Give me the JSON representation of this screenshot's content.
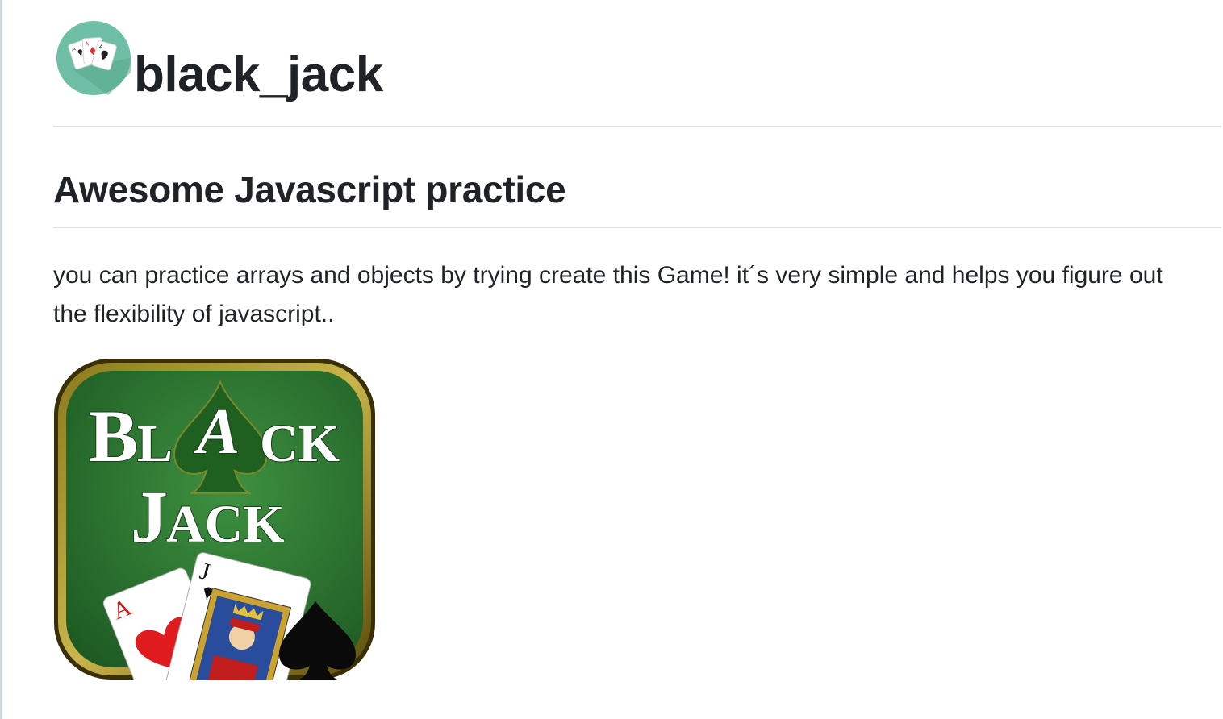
{
  "repo": {
    "title": "black_jack",
    "logo_icon": "playing-cards-logo-icon"
  },
  "section": {
    "heading": "Awesome Javascript practice",
    "paragraph": "you can practice arrays and objects by trying create this Game! it´s very simple and helps you figure out the flexibility of javascript.."
  },
  "image": {
    "line1": "BLACK",
    "line2": "JACK",
    "card_ace": "A",
    "card_jack": "J"
  },
  "colors": {
    "logo_bg": "#6ebfa5",
    "felt_green": "#2f7a32",
    "gold_border": "#6b5a12",
    "text": "#1f2328"
  }
}
